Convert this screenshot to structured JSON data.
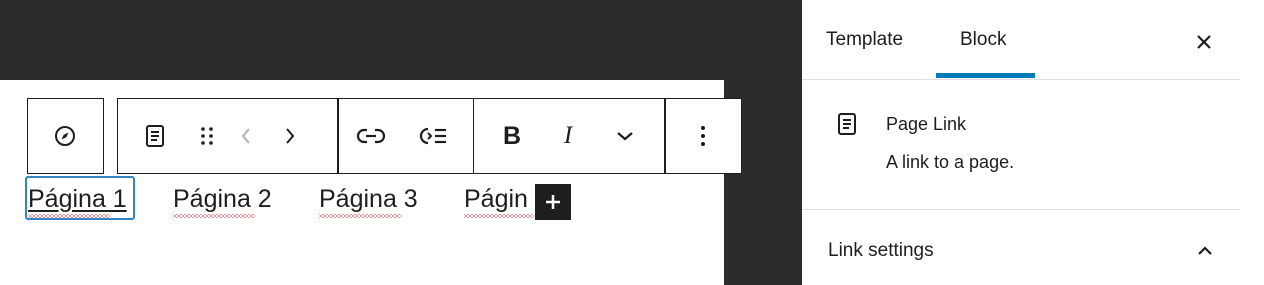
{
  "navigation": {
    "links": [
      {
        "label": "Página 1"
      },
      {
        "label": "Página 2"
      },
      {
        "label": "Página 3"
      },
      {
        "label": "Págin"
      }
    ]
  },
  "toolbar": {
    "icons": [
      "compass-icon",
      "page-icon",
      "drag-handle-icon",
      "chevron-left-icon",
      "chevron-right-icon",
      "link-icon",
      "submenu-icon",
      "bold-icon",
      "italic-icon",
      "chevron-down-icon",
      "more-vertical-icon"
    ],
    "bold_label": "B",
    "italic_label": "I"
  },
  "sidebar": {
    "tabs": [
      {
        "label": "Template",
        "active": false
      },
      {
        "label": "Block",
        "active": true
      }
    ],
    "block": {
      "title": "Page Link",
      "description": "A link to a page.",
      "icon": "page-icon"
    },
    "panel": {
      "title": "Link settings",
      "expanded": true
    }
  },
  "colors": {
    "accent": "#007cba",
    "selection": "#3582c4",
    "dark_bg": "#2c2c2c",
    "spelling": "#d63638"
  }
}
